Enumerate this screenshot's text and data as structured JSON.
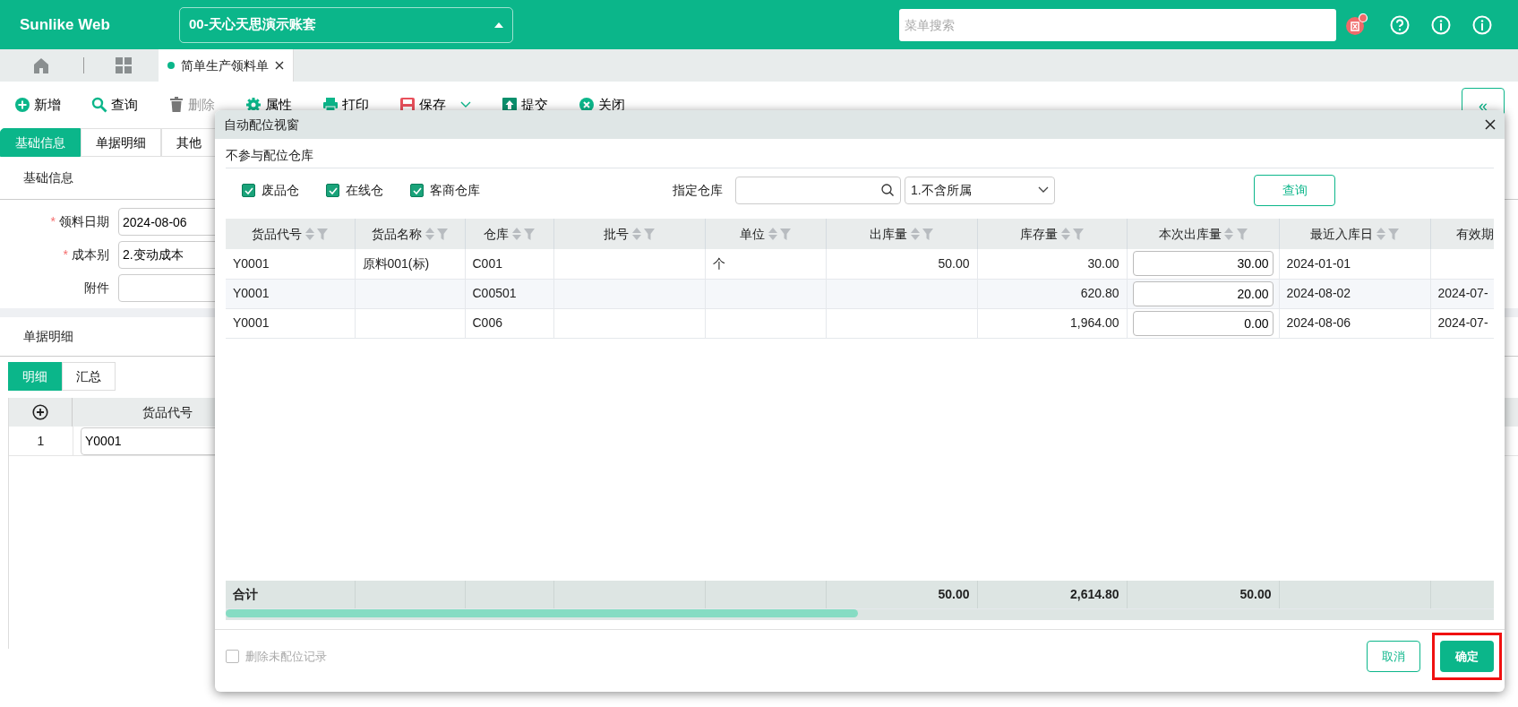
{
  "header": {
    "logo": "Sunlike Web",
    "account": "00-天心天思演示账套",
    "search": {
      "placeholder": "菜单搜索"
    },
    "alerts": {
      "unread": true
    }
  },
  "nav": {
    "tabs": [
      {
        "label": "简单生产领料单",
        "selected": true
      }
    ]
  },
  "toolbar": [
    {
      "kind": "add",
      "label": "新增",
      "disabled": false
    },
    {
      "kind": "query",
      "label": "查询",
      "disabled": false
    },
    {
      "kind": "delete",
      "label": "删除",
      "disabled": true
    },
    {
      "kind": "props",
      "label": "属性",
      "disabled": false
    },
    {
      "kind": "print",
      "label": "打印",
      "disabled": false
    },
    {
      "kind": "save",
      "label": "保存",
      "disabled": false,
      "dropdown": true
    },
    {
      "kind": "submit",
      "label": "提交",
      "disabled": false
    },
    {
      "kind": "close",
      "label": "关闭",
      "disabled": false
    }
  ],
  "collapse_button": "«",
  "form_tabs": [
    {
      "label": "基础信息",
      "selected": true
    },
    {
      "label": "单据明细",
      "selected": false
    },
    {
      "label": "其他",
      "selected": false
    }
  ],
  "basic_section": {
    "title": "基础信息",
    "fields": [
      {
        "label": "领料日期",
        "required_mark": "*",
        "value": "2024-08-06"
      },
      {
        "label": "成本别",
        "required_mark": "*",
        "value": "2.变动成本"
      },
      {
        "label": "附件"
      }
    ]
  },
  "detail_section": {
    "title": "单据明细",
    "views": [
      {
        "label": "明细",
        "selected": true
      },
      {
        "label": "汇总",
        "selected": false
      }
    ],
    "column": "货品代号",
    "rows": [
      {
        "index": "1",
        "code": "Y0001"
      }
    ]
  },
  "dialog": {
    "title": "自动配位视窗",
    "exclude_label": "不参与配位仓库",
    "exclude": [
      {
        "label": "废品仓",
        "checked": true
      },
      {
        "label": "在线仓",
        "checked": true
      },
      {
        "label": "客商仓库",
        "checked": true
      }
    ],
    "warehouse_label": "指定仓库",
    "scope": "1.不含所属",
    "query_button": "查询",
    "columns": [
      {
        "label": "货品代号",
        "kind": "text",
        "sort_icons": true
      },
      {
        "label": "货品名称",
        "kind": "text",
        "sort_icons": true
      },
      {
        "label": "仓库",
        "kind": "text",
        "sort_icons": true
      },
      {
        "label": "批号",
        "kind": "text",
        "sort_icons": true
      },
      {
        "label": "单位",
        "kind": "text",
        "sort_icons": true
      },
      {
        "label": "出库量",
        "kind": "number",
        "sort_icons": true
      },
      {
        "label": "库存量",
        "kind": "number",
        "sort_icons": true
      },
      {
        "label": "本次出库量",
        "kind": "input",
        "sort_icons": true
      },
      {
        "label": "最近入库日",
        "kind": "text",
        "sort_icons": true
      },
      {
        "label": "有效期",
        "kind": "text",
        "sort_icons": false
      }
    ],
    "rows": [
      {
        "code": "Y0001",
        "name": "原料001(标)",
        "warehouse": "C001",
        "unit": "个",
        "out_qty": "50.00",
        "stock_qty": "30.00",
        "this_qty": "30.00",
        "last_in": "2024-01-01"
      },
      {
        "code": "Y0001",
        "warehouse": "C00501",
        "stock_qty": "620.80",
        "this_qty": "20.00",
        "last_in": "2024-08-02",
        "expiry": "2024-07-"
      },
      {
        "code": "Y0001",
        "warehouse": "C006",
        "stock_qty": "1,964.00",
        "this_qty": "0.00",
        "last_in": "2024-08-06",
        "expiry": "2024-07-"
      }
    ],
    "totals": {
      "label": "合计",
      "out_qty": "50.00",
      "stock_qty": "2,614.80",
      "this_qty": "50.00"
    },
    "delete_unassigned": {
      "label": "删除未配位记录",
      "checked": false,
      "disabled": true
    },
    "buttons": [
      {
        "label": "取消",
        "kind": "outline",
        "highlighted": false
      },
      {
        "label": "确定",
        "kind": "primary",
        "highlighted": true
      }
    ]
  }
}
